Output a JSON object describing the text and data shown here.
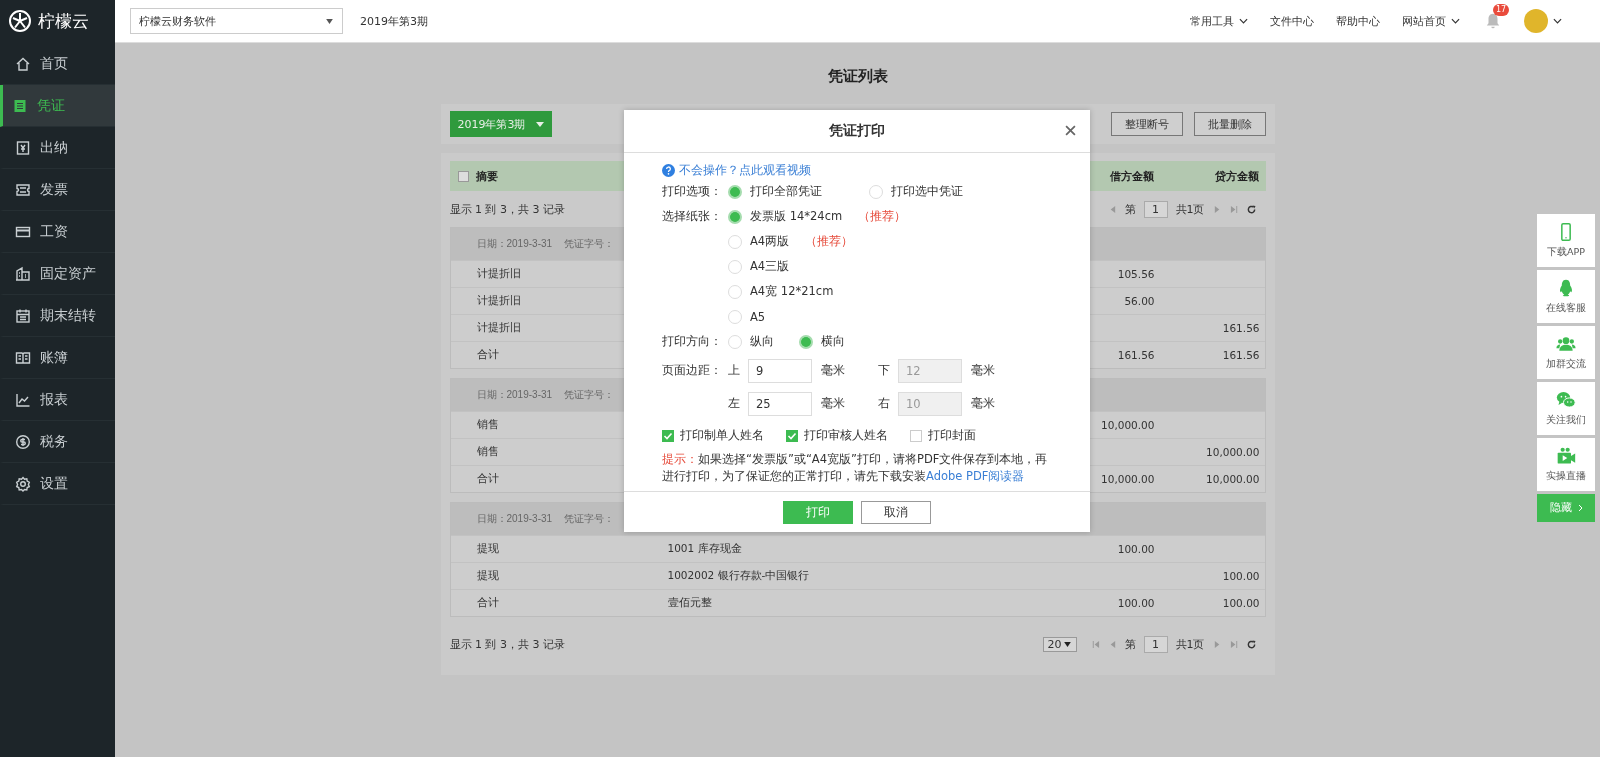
{
  "app": {
    "logo": "柠檬云"
  },
  "top_bar": {
    "company_select": "柠檬云财务软件",
    "period": "2019年第3期",
    "menu": [
      {
        "label": "常用工具",
        "dropdown": true
      },
      {
        "label": "文件中心",
        "dropdown": false
      },
      {
        "label": "帮助中心",
        "dropdown": false
      },
      {
        "label": "网站首页",
        "dropdown": true
      }
    ],
    "notifications": "17"
  },
  "sidebar": {
    "items": [
      {
        "label": "首页",
        "kind": "home",
        "selected": false
      },
      {
        "label": "凭证",
        "kind": "voucher",
        "selected": true
      },
      {
        "label": "出纳",
        "kind": "cash",
        "selected": false
      },
      {
        "label": "发票",
        "kind": "invoice",
        "selected": false
      },
      {
        "label": "工资",
        "kind": "salary",
        "selected": false
      },
      {
        "label": "固定资产",
        "kind": "asset",
        "selected": false
      },
      {
        "label": "期末结转",
        "kind": "calendar",
        "selected": false
      },
      {
        "label": "账簿",
        "kind": "book",
        "selected": false
      },
      {
        "label": "报表",
        "kind": "chart",
        "selected": false
      },
      {
        "label": "税务",
        "kind": "tax",
        "selected": false
      },
      {
        "label": "设置",
        "kind": "settings",
        "selected": false
      }
    ]
  },
  "page": {
    "title": "凭证列表",
    "period_button": "2019年第3期",
    "actions": [
      "整理断号",
      "批量删除"
    ],
    "table": {
      "select_all_checked": false,
      "columns": [
        "摘要",
        "借方金额",
        "贷方金额"
      ],
      "top_summary": "显示 1 到 3，共 3 记录",
      "top_pager": {
        "prefix": "第",
        "page": "1",
        "total": "共1页"
      },
      "groups": [
        {
          "date": "日期：2019-3-31",
          "voucher_no": "凭证字号：",
          "rows": [
            {
              "summary": "计提折旧",
              "debit": "105.56"
            },
            {
              "summary": "计提折旧",
              "debit": "56.00"
            },
            {
              "summary": "计提折旧",
              "credit": "161.56"
            },
            {
              "summary": "合计",
              "debit": "161.56",
              "credit": "161.56"
            }
          ]
        },
        {
          "date": "日期：2019-3-31",
          "voucher_no": "凭证字号：",
          "rows": [
            {
              "summary": "销售",
              "debit": "10,000.00"
            },
            {
              "summary": "销售",
              "credit": "10,000.00"
            },
            {
              "summary": "合计",
              "debit": "10,000.00",
              "credit": "10,000.00"
            }
          ]
        },
        {
          "date": "日期：2019-3-31",
          "voucher_no": "凭证字号：",
          "rows": [
            {
              "summary": "提现",
              "account": "1001 库存现金",
              "debit": "100.00"
            },
            {
              "summary": "提现",
              "account": "1002002 银行存款-中国银行",
              "credit": "100.00"
            },
            {
              "summary": "合计",
              "account": "壹佰元整",
              "debit": "100.00",
              "credit": "100.00"
            }
          ]
        }
      ],
      "bottom_summary": "显示 1 到 3，共 3 记录",
      "bottom_pager": {
        "page_size": "20",
        "prefix": "第",
        "page": "1",
        "total": "共1页"
      }
    }
  },
  "dialog": {
    "title": "凭证打印",
    "help_link": "不会操作？点此观看视频",
    "print_option": {
      "label": "打印选项：",
      "options": [
        {
          "label": "打印全部凭证",
          "selected": true
        },
        {
          "label": "打印选中凭证",
          "selected": false
        }
      ]
    },
    "paper": {
      "label": "选择纸张：",
      "options": [
        {
          "label": "发票版 14*24cm",
          "tag": "（推荐）",
          "selected": true
        },
        {
          "label": "A4两版",
          "tag": "（推荐）",
          "selected": false
        },
        {
          "label": "A4三版",
          "selected": false
        },
        {
          "label": "A4宽 12*21cm",
          "selected": false
        },
        {
          "label": "A5",
          "selected": false
        }
      ]
    },
    "orientation": {
      "label": "打印方向：",
      "options": [
        {
          "label": "纵向",
          "selected": false
        },
        {
          "label": "横向",
          "selected": true
        }
      ]
    },
    "margins": {
      "label": "页面边距：",
      "fields": [
        {
          "side": "上",
          "value": "9",
          "unit": "毫米",
          "disabled": false
        },
        {
          "side": "下",
          "value": "12",
          "unit": "毫米",
          "disabled": true
        },
        {
          "side": "左",
          "value": "25",
          "unit": "毫米",
          "disabled": false
        },
        {
          "side": "右",
          "value": "10",
          "unit": "毫米",
          "disabled": true
        }
      ]
    },
    "checkboxes": [
      {
        "label": "打印制单人姓名",
        "checked": true
      },
      {
        "label": "打印审核人姓名",
        "checked": true
      },
      {
        "label": "打印封面",
        "checked": false
      }
    ],
    "hint": {
      "label": "提示：",
      "text": "如果选择“发票版”或“A4宽版”打印，请将PDF文件保存到本地，再进行打印，为了保证您的正常打印，请先下载安装",
      "link": "Adobe PDF阅读器"
    },
    "buttons": [
      {
        "label": "打印",
        "kind": "primary"
      },
      {
        "label": "取消",
        "kind": "secondary"
      }
    ]
  },
  "float_bar": {
    "items": [
      {
        "label": "下载APP",
        "kind": "phone"
      },
      {
        "label": "在线客服",
        "kind": "penguin"
      },
      {
        "label": "加群交流",
        "kind": "group"
      },
      {
        "label": "关注我们",
        "kind": "chat"
      },
      {
        "label": "实操直播",
        "kind": "camera"
      }
    ],
    "hide_button": "隐藏"
  }
}
